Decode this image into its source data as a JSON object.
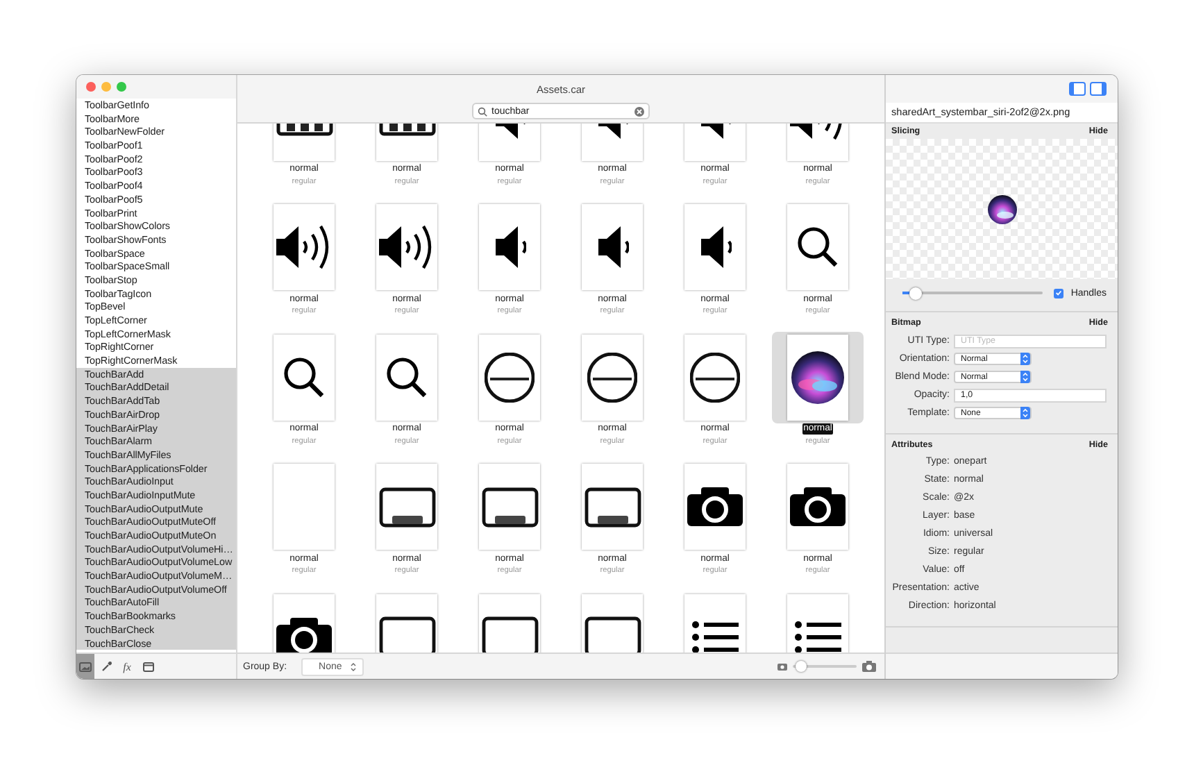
{
  "window": {
    "title": "Assets.car"
  },
  "sidebar": {
    "items": [
      {
        "label": "ToolbarGetInfo",
        "selected": false
      },
      {
        "label": "ToolbarMore",
        "selected": false
      },
      {
        "label": "ToolbarNewFolder",
        "selected": false
      },
      {
        "label": "ToolbarPoof1",
        "selected": false
      },
      {
        "label": "ToolbarPoof2",
        "selected": false
      },
      {
        "label": "ToolbarPoof3",
        "selected": false
      },
      {
        "label": "ToolbarPoof4",
        "selected": false
      },
      {
        "label": "ToolbarPoof5",
        "selected": false
      },
      {
        "label": "ToolbarPrint",
        "selected": false
      },
      {
        "label": "ToolbarShowColors",
        "selected": false
      },
      {
        "label": "ToolbarShowFonts",
        "selected": false
      },
      {
        "label": "ToolbarSpace",
        "selected": false
      },
      {
        "label": "ToolbarSpaceSmall",
        "selected": false
      },
      {
        "label": "ToolbarStop",
        "selected": false
      },
      {
        "label": "ToolbarTagIcon",
        "selected": false
      },
      {
        "label": "TopBevel",
        "selected": false
      },
      {
        "label": "TopLeftCorner",
        "selected": false
      },
      {
        "label": "TopLeftCornerMask",
        "selected": false
      },
      {
        "label": "TopRightCorner",
        "selected": false
      },
      {
        "label": "TopRightCornerMask",
        "selected": false
      },
      {
        "label": "TouchBarAdd",
        "selected": true
      },
      {
        "label": "TouchBarAddDetail",
        "selected": true
      },
      {
        "label": "TouchBarAddTab",
        "selected": true
      },
      {
        "label": "TouchBarAirDrop",
        "selected": true
      },
      {
        "label": "TouchBarAirPlay",
        "selected": true
      },
      {
        "label": "TouchBarAlarm",
        "selected": true
      },
      {
        "label": "TouchBarAllMyFiles",
        "selected": true
      },
      {
        "label": "TouchBarApplicationsFolder",
        "selected": true
      },
      {
        "label": "TouchBarAudioInput",
        "selected": true
      },
      {
        "label": "TouchBarAudioInputMute",
        "selected": true
      },
      {
        "label": "TouchBarAudioOutputMute",
        "selected": true
      },
      {
        "label": "TouchBarAudioOutputMuteOff",
        "selected": true
      },
      {
        "label": "TouchBarAudioOutputMuteOn",
        "selected": true
      },
      {
        "label": "TouchBarAudioOutputVolumeHi…",
        "selected": true
      },
      {
        "label": "TouchBarAudioOutputVolumeLow",
        "selected": true
      },
      {
        "label": "TouchBarAudioOutputVolumeM…",
        "selected": true
      },
      {
        "label": "TouchBarAudioOutputVolumeOff",
        "selected": true
      },
      {
        "label": "TouchBarAutoFill",
        "selected": true
      },
      {
        "label": "TouchBarBookmarks",
        "selected": true
      },
      {
        "label": "TouchBarCheck",
        "selected": true
      },
      {
        "label": "TouchBarClose",
        "selected": true
      }
    ],
    "footer": [
      {
        "kind": "image",
        "selected": true
      },
      {
        "kind": "eyedropper",
        "selected": false
      },
      {
        "kind": "function",
        "label": "fx",
        "selected": false
      },
      {
        "kind": "window",
        "selected": false
      }
    ]
  },
  "search": {
    "value": "touchbar"
  },
  "grid": {
    "items": [
      {
        "kind": "keyboard",
        "state": "normal",
        "size": "regular",
        "selected": false
      },
      {
        "kind": "keyboard",
        "state": "normal",
        "size": "regular",
        "selected": false
      },
      {
        "kind": "speaker-1",
        "state": "normal",
        "size": "regular",
        "selected": false
      },
      {
        "kind": "speaker-1",
        "state": "normal",
        "size": "regular",
        "selected": false
      },
      {
        "kind": "speaker-1",
        "state": "normal",
        "size": "regular",
        "selected": false
      },
      {
        "kind": "speaker-3",
        "state": "normal",
        "size": "regular",
        "selected": false
      },
      {
        "kind": "speaker-3",
        "state": "normal",
        "size": "regular",
        "selected": false
      },
      {
        "kind": "speaker-3",
        "state": "normal",
        "size": "regular",
        "selected": false
      },
      {
        "kind": "speaker-1",
        "state": "normal",
        "size": "regular",
        "selected": false
      },
      {
        "kind": "speaker-1",
        "state": "normal",
        "size": "regular",
        "selected": false
      },
      {
        "kind": "speaker-1",
        "state": "normal",
        "size": "regular",
        "selected": false
      },
      {
        "kind": "search",
        "state": "normal",
        "size": "regular",
        "selected": false
      },
      {
        "kind": "search",
        "state": "normal",
        "size": "regular",
        "selected": false
      },
      {
        "kind": "search",
        "state": "normal",
        "size": "regular",
        "selected": false
      },
      {
        "kind": "circle-minus",
        "state": "normal",
        "size": "regular",
        "selected": false
      },
      {
        "kind": "circle-minus",
        "state": "normal",
        "size": "regular",
        "selected": false
      },
      {
        "kind": "circle-minus",
        "state": "normal",
        "size": "regular",
        "selected": false
      },
      {
        "kind": "orb",
        "state": "normal",
        "size": "regular",
        "selected": true
      },
      {
        "kind": "blank",
        "state": "normal",
        "size": "regular",
        "selected": false
      },
      {
        "kind": "tray",
        "state": "normal",
        "size": "regular",
        "selected": false
      },
      {
        "kind": "tray",
        "state": "normal",
        "size": "regular",
        "selected": false
      },
      {
        "kind": "tray",
        "state": "normal",
        "size": "regular",
        "selected": false
      },
      {
        "kind": "camera",
        "state": "normal",
        "size": "regular",
        "selected": false
      },
      {
        "kind": "camera",
        "state": "normal",
        "size": "regular",
        "selected": false
      },
      {
        "kind": "camera",
        "selected": false
      },
      {
        "kind": "frame",
        "selected": false
      },
      {
        "kind": "frame",
        "selected": false
      },
      {
        "kind": "frame",
        "selected": false
      },
      {
        "kind": "list",
        "selected": false
      },
      {
        "kind": "list",
        "selected": false
      }
    ]
  },
  "bottom_bar": {
    "group_by_label": "Group By:",
    "group_by_value": "None",
    "zoom": {
      "level": 0.1
    }
  },
  "inspector": {
    "filename": "sharedArt_systembar_siri-2of2@2x.png",
    "slicing": {
      "title": "Slicing",
      "hide": "Hide",
      "level": 0.08,
      "handles": {
        "label": "Handles",
        "checked": true
      }
    },
    "bitmap": {
      "title": "Bitmap",
      "hide": "Hide",
      "fields": [
        {
          "label": "UTI Type:",
          "kind": "text",
          "placeholder": "UTI Type"
        },
        {
          "label": "Orientation:",
          "kind": "select",
          "value": "Normal"
        },
        {
          "label": "Blend Mode:",
          "kind": "select",
          "value": "Normal"
        },
        {
          "label": "Opacity:",
          "kind": "text",
          "value": "1,0"
        },
        {
          "label": "Template:",
          "kind": "select",
          "value": "None"
        }
      ]
    },
    "attributes": {
      "title": "Attributes",
      "hide": "Hide",
      "rows": [
        {
          "label": "Type:",
          "value": "onepart"
        },
        {
          "label": "State:",
          "value": "normal"
        },
        {
          "label": "Scale:",
          "value": "@2x"
        },
        {
          "label": "Layer:",
          "value": "base"
        },
        {
          "label": "Idiom:",
          "value": "universal"
        },
        {
          "label": "Size:",
          "value": "regular"
        },
        {
          "label": "Value:",
          "value": "off"
        },
        {
          "label": "Presentation:",
          "value": "active"
        },
        {
          "label": "Direction:",
          "value": "horizontal"
        }
      ]
    }
  }
}
